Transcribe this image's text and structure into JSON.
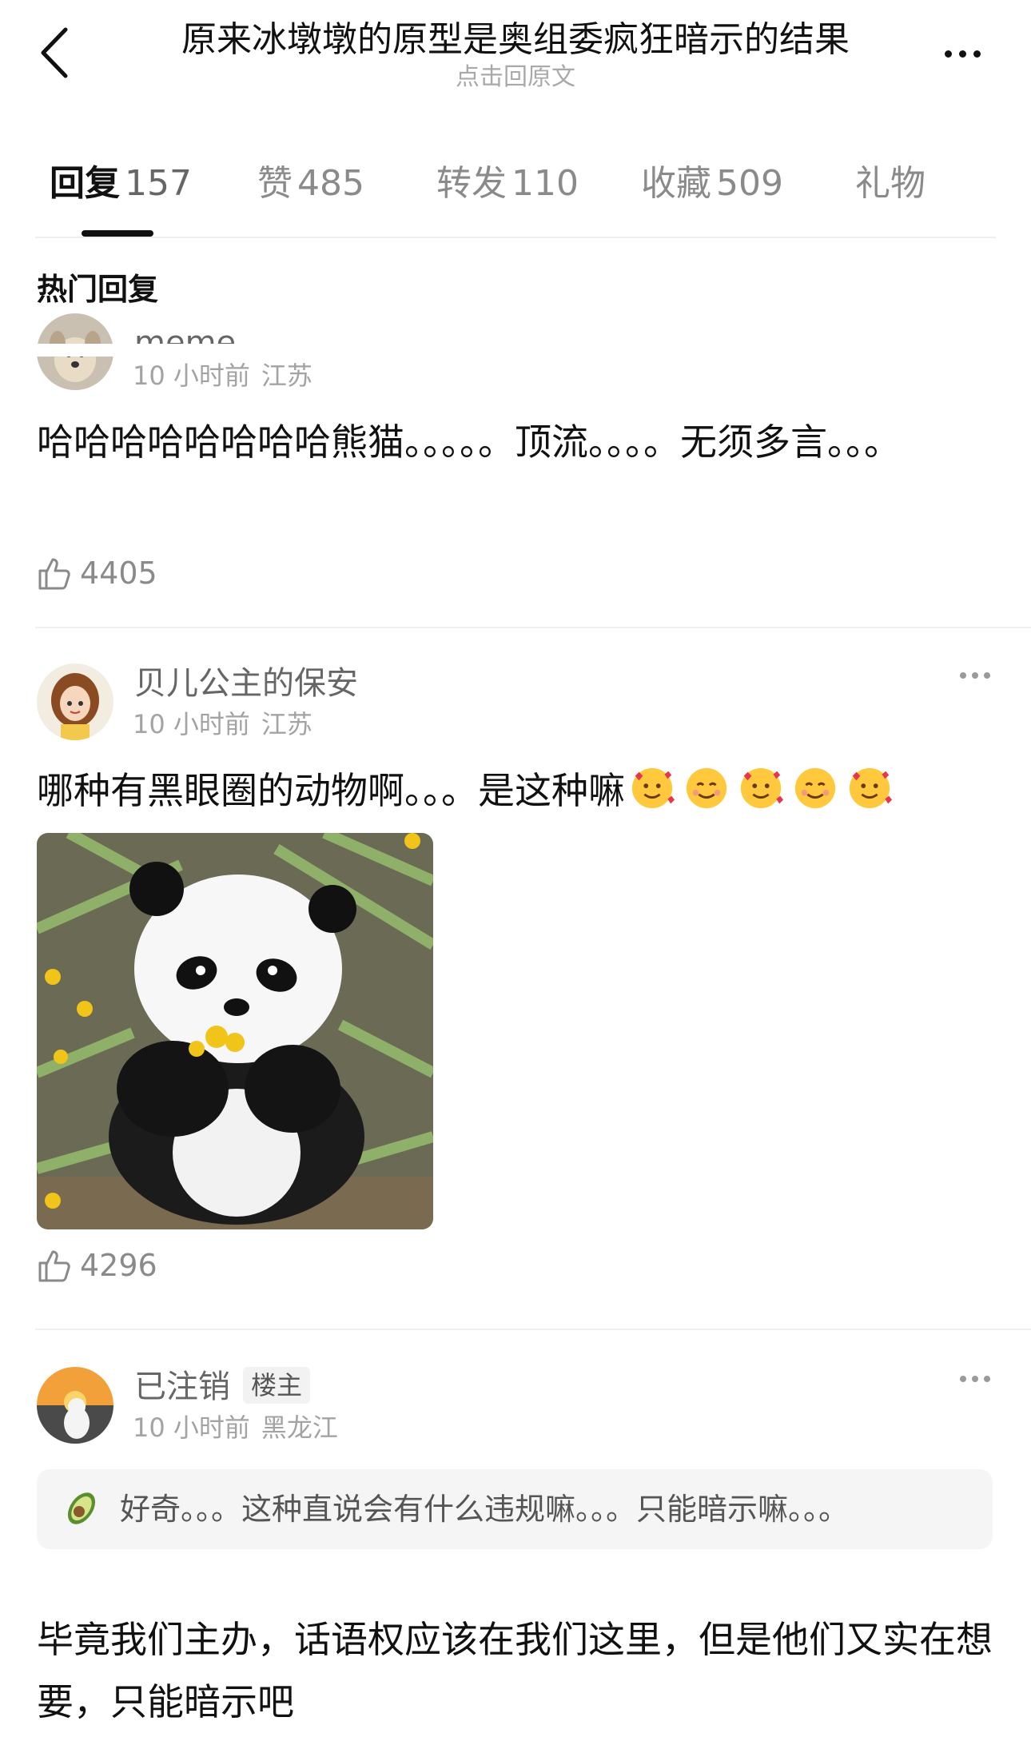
{
  "header": {
    "title": "原来冰墩墩的原型是奥组委疯狂暗示的结果",
    "subtitle": "点击回原文"
  },
  "tabs": [
    {
      "label": "回复",
      "count": "157"
    },
    {
      "label": "赞",
      "count": "485"
    },
    {
      "label": "转发",
      "count": "110"
    },
    {
      "label": "收藏",
      "count": "509"
    },
    {
      "label": "礼物",
      "count": ""
    }
  ],
  "section_title": "热门回复",
  "comments": [
    {
      "username": "meme",
      "time": "10 小时前",
      "location": "江苏",
      "text": "哈哈哈哈哈哈哈哈熊猫。。。。。顶流。。。。无须多言。。。",
      "likes": "4405",
      "avatar": "dog-avatar"
    },
    {
      "username": "贝儿公主的保安",
      "time": "10 小时前",
      "location": "江苏",
      "text": "哪种有黑眼圈的动物啊。。。是这种嘛",
      "emojis": [
        "smiling-face-with-hearts",
        "smiling-face",
        "smiling-face-with-hearts",
        "smiling-face",
        "smiling-face-with-hearts"
      ],
      "likes": "4296",
      "avatar": "princess-avatar",
      "image": "panda-photo"
    },
    {
      "username": "已注销",
      "badge": "楼主",
      "time": "10 小时前",
      "location": "黑龙江",
      "quote": "好奇。。。这种直说会有什么违规嘛。。。只能暗示嘛。。。",
      "quote_icon": "avocado-icon",
      "text": "毕竟我们主办，话语权应该在我们这里，但是他们又实在想要，只能暗示吧",
      "avatar": "sunset-dog-avatar"
    }
  ],
  "colors": {
    "primary_text": "#111111",
    "secondary_text": "#8a8a8a",
    "meta_text": "#a3a3a3",
    "divider": "#efefef",
    "quote_bg": "#f5f5f5"
  }
}
